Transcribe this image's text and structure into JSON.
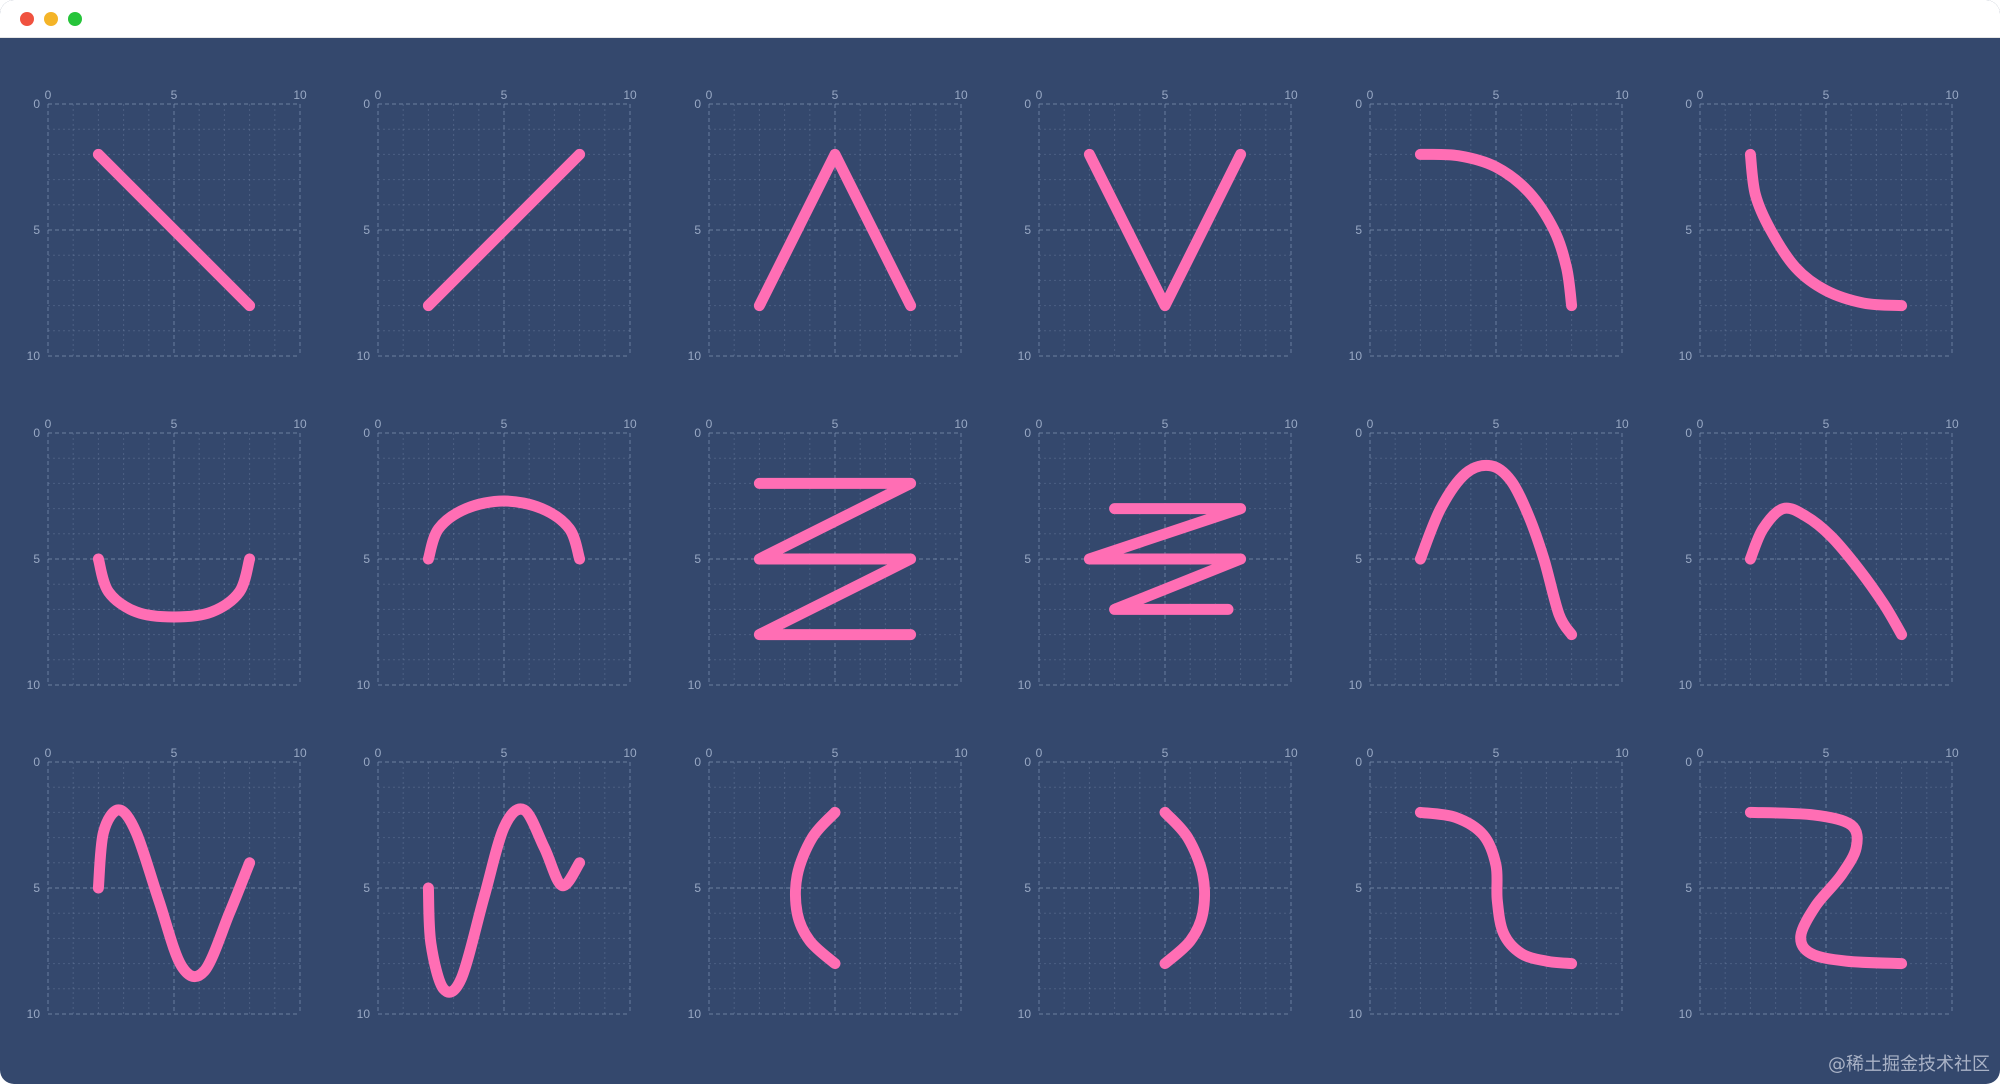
{
  "window": {
    "controls": [
      "close",
      "minimize",
      "maximize"
    ]
  },
  "theme": {
    "background": "#34486d",
    "curve_color": "#ff6eb4",
    "grid_line": "#7f92b2",
    "label_color": "#98a8c4"
  },
  "axes": {
    "x_ticks": [
      "0",
      "5",
      "10"
    ],
    "y_ticks": [
      "0",
      "5",
      "10"
    ]
  },
  "chart_data": [
    {
      "type": "line",
      "xlim": [
        0,
        10
      ],
      "ylim": [
        0,
        10
      ],
      "grid": true,
      "y_inverted": true,
      "series": [
        {
          "values": [
            [
              2,
              2
            ],
            [
              8,
              8
            ]
          ]
        }
      ]
    },
    {
      "type": "line",
      "xlim": [
        0,
        10
      ],
      "ylim": [
        0,
        10
      ],
      "grid": true,
      "y_inverted": true,
      "series": [
        {
          "values": [
            [
              2,
              8
            ],
            [
              8,
              2
            ]
          ]
        }
      ]
    },
    {
      "type": "line",
      "xlim": [
        0,
        10
      ],
      "ylim": [
        0,
        10
      ],
      "grid": true,
      "y_inverted": true,
      "series": [
        {
          "values": [
            [
              2,
              8
            ],
            [
              5,
              2
            ],
            [
              8,
              8
            ]
          ]
        }
      ]
    },
    {
      "type": "line",
      "xlim": [
        0,
        10
      ],
      "ylim": [
        0,
        10
      ],
      "grid": true,
      "y_inverted": true,
      "series": [
        {
          "values": [
            [
              2,
              2
            ],
            [
              5,
              8
            ],
            [
              8,
              2
            ]
          ]
        }
      ]
    },
    {
      "type": "line",
      "xlim": [
        0,
        10
      ],
      "ylim": [
        0,
        10
      ],
      "grid": true,
      "y_inverted": true,
      "series": [
        {
          "values": [
            [
              2,
              2
            ],
            [
              3.5,
              2.05
            ],
            [
              5,
              2.5
            ],
            [
              6.3,
              3.5
            ],
            [
              7.3,
              5
            ],
            [
              7.8,
              6.5
            ],
            [
              8,
              8
            ]
          ]
        }
      ]
    },
    {
      "type": "line",
      "xlim": [
        0,
        10
      ],
      "ylim": [
        0,
        10
      ],
      "grid": true,
      "y_inverted": true,
      "series": [
        {
          "values": [
            [
              2,
              2
            ],
            [
              2.2,
              3.6
            ],
            [
              2.8,
              5
            ],
            [
              3.8,
              6.5
            ],
            [
              5,
              7.4
            ],
            [
              6.5,
              7.9
            ],
            [
              8,
              8
            ]
          ]
        }
      ]
    },
    {
      "type": "line",
      "xlim": [
        0,
        10
      ],
      "ylim": [
        0,
        10
      ],
      "grid": true,
      "y_inverted": true,
      "series": [
        {
          "values": [
            [
              2,
              5
            ],
            [
              2.4,
              6.3
            ],
            [
              3.5,
              7.1
            ],
            [
              5,
              7.3
            ],
            [
              6.5,
              7.1
            ],
            [
              7.6,
              6.3
            ],
            [
              8,
              5
            ]
          ]
        }
      ]
    },
    {
      "type": "line",
      "xlim": [
        0,
        10
      ],
      "ylim": [
        0,
        10
      ],
      "grid": true,
      "y_inverted": true,
      "series": [
        {
          "values": [
            [
              2,
              5
            ],
            [
              2.4,
              3.8
            ],
            [
              3.5,
              3
            ],
            [
              5,
              2.7
            ],
            [
              6.5,
              3
            ],
            [
              7.6,
              3.8
            ],
            [
              8,
              5
            ]
          ]
        }
      ]
    },
    {
      "type": "line",
      "xlim": [
        0,
        10
      ],
      "ylim": [
        0,
        10
      ],
      "grid": true,
      "y_inverted": true,
      "series": [
        {
          "values": [
            [
              2,
              2
            ],
            [
              8,
              2
            ],
            [
              2,
              5
            ],
            [
              8,
              5
            ],
            [
              2,
              8
            ],
            [
              8,
              8
            ]
          ]
        }
      ]
    },
    {
      "type": "line",
      "xlim": [
        0,
        10
      ],
      "ylim": [
        0,
        10
      ],
      "grid": true,
      "y_inverted": true,
      "series": [
        {
          "values": [
            [
              3,
              3
            ],
            [
              8,
              3
            ],
            [
              2,
              5
            ],
            [
              8,
              5
            ],
            [
              3,
              7
            ],
            [
              7.5,
              7
            ]
          ]
        }
      ]
    },
    {
      "type": "line",
      "xlim": [
        0,
        10
      ],
      "ylim": [
        0,
        10
      ],
      "grid": true,
      "y_inverted": true,
      "series": [
        {
          "values": [
            [
              2,
              5
            ],
            [
              2.8,
              3
            ],
            [
              3.8,
              1.6
            ],
            [
              4.8,
              1.3
            ],
            [
              5.6,
              1.9
            ],
            [
              6.3,
              3.3
            ],
            [
              6.9,
              5
            ],
            [
              7.5,
              7.2
            ],
            [
              8,
              8
            ]
          ]
        }
      ]
    },
    {
      "type": "line",
      "xlim": [
        0,
        10
      ],
      "ylim": [
        0,
        10
      ],
      "grid": true,
      "y_inverted": true,
      "series": [
        {
          "values": [
            [
              2,
              5
            ],
            [
              2.5,
              3.8
            ],
            [
              3.3,
              3
            ],
            [
              4.2,
              3.3
            ],
            [
              5.2,
              4.1
            ],
            [
              6.3,
              5.4
            ],
            [
              7.3,
              6.8
            ],
            [
              8,
              8
            ]
          ]
        }
      ]
    },
    {
      "type": "line",
      "xlim": [
        0,
        10
      ],
      "ylim": [
        0,
        10
      ],
      "grid": true,
      "y_inverted": true,
      "series": [
        {
          "values": [
            [
              2,
              5
            ],
            [
              2.2,
              2.8
            ],
            [
              2.8,
              1.9
            ],
            [
              3.5,
              2.8
            ],
            [
              4.4,
              5.5
            ],
            [
              5.3,
              8.1
            ],
            [
              6.2,
              8.3
            ],
            [
              7.2,
              6
            ],
            [
              8,
              4
            ]
          ]
        }
      ]
    },
    {
      "type": "line",
      "xlim": [
        0,
        10
      ],
      "ylim": [
        0,
        10
      ],
      "grid": true,
      "y_inverted": true,
      "series": [
        {
          "values": [
            [
              2,
              5
            ],
            [
              2.1,
              7.2
            ],
            [
              2.6,
              9
            ],
            [
              3.3,
              8.6
            ],
            [
              4.2,
              5.4
            ],
            [
              5,
              2.6
            ],
            [
              5.8,
              1.9
            ],
            [
              6.6,
              3.4
            ],
            [
              7.3,
              4.9
            ],
            [
              8,
              4
            ]
          ]
        }
      ]
    },
    {
      "type": "line",
      "xlim": [
        0,
        10
      ],
      "ylim": [
        0,
        10
      ],
      "grid": true,
      "y_inverted": true,
      "series": [
        {
          "values": [
            [
              5,
              2
            ],
            [
              4.1,
              3
            ],
            [
              3.5,
              4.5
            ],
            [
              3.5,
              6
            ],
            [
              4,
              7.1
            ],
            [
              5,
              8
            ]
          ]
        }
      ]
    },
    {
      "type": "line",
      "xlim": [
        0,
        10
      ],
      "ylim": [
        0,
        10
      ],
      "grid": true,
      "y_inverted": true,
      "series": [
        {
          "values": [
            [
              5,
              2
            ],
            [
              5.9,
              3
            ],
            [
              6.5,
              4.5
            ],
            [
              6.5,
              6
            ],
            [
              6,
              7.1
            ],
            [
              5,
              8
            ]
          ]
        }
      ]
    },
    {
      "type": "line",
      "xlim": [
        0,
        10
      ],
      "ylim": [
        0,
        10
      ],
      "grid": true,
      "y_inverted": true,
      "series": [
        {
          "values": [
            [
              2,
              2
            ],
            [
              3.4,
              2.2
            ],
            [
              4.5,
              2.9
            ],
            [
              5,
              4.1
            ],
            [
              5.05,
              5.5
            ],
            [
              5.3,
              6.8
            ],
            [
              6,
              7.6
            ],
            [
              7,
              7.9
            ],
            [
              8,
              8
            ]
          ]
        }
      ]
    },
    {
      "type": "line",
      "xlim": [
        0,
        10
      ],
      "ylim": [
        0,
        10
      ],
      "grid": true,
      "y_inverted": true,
      "series": [
        {
          "values": [
            [
              2,
              2
            ],
            [
              4.5,
              2.1
            ],
            [
              6,
              2.5
            ],
            [
              6.2,
              3.4
            ],
            [
              5.6,
              4.5
            ],
            [
              4.6,
              5.7
            ],
            [
              4,
              6.9
            ],
            [
              4.4,
              7.6
            ],
            [
              5.8,
              7.9
            ],
            [
              8,
              8
            ]
          ]
        }
      ]
    }
  ],
  "watermark": "@稀土掘金技术社区"
}
